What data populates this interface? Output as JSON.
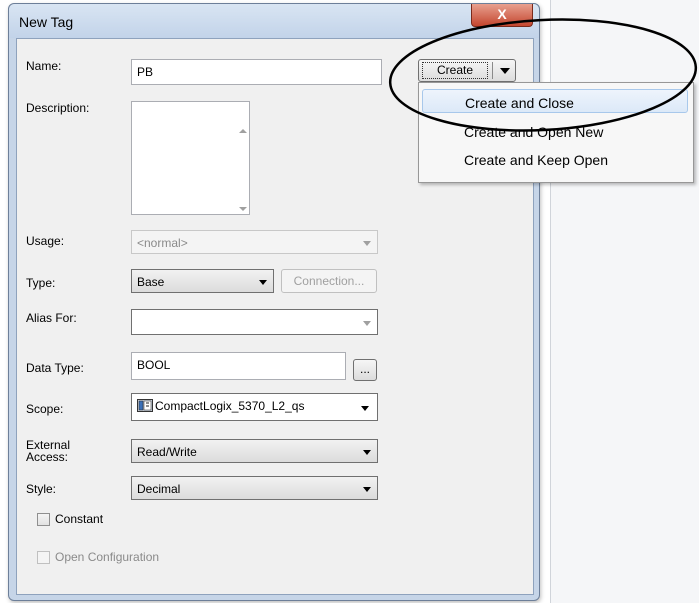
{
  "dialog": {
    "title": "New Tag",
    "close_label": "X"
  },
  "form": {
    "name": {
      "label": "Name:",
      "value": "PB"
    },
    "description": {
      "label": "Description:",
      "value": ""
    },
    "usage": {
      "label": "Usage:",
      "value": "<normal>"
    },
    "type": {
      "label": "Type:",
      "value": "Base",
      "connection_label": "Connection..."
    },
    "alias_for": {
      "label": "Alias For:",
      "value": ""
    },
    "data_type": {
      "label": "Data Type:",
      "value": "BOOL",
      "browse_label": "..."
    },
    "scope": {
      "label": "Scope:",
      "value": "CompactLogix_5370_L2_qs",
      "icon": "controller-icon"
    },
    "external_access": {
      "label_line1": "External",
      "label_line2": "Access:",
      "value": "Read/Write"
    },
    "style": {
      "label": "Style:",
      "value": "Decimal"
    },
    "constant": {
      "label": "Constant",
      "checked": false
    },
    "open_configuration": {
      "label": "Open Configuration",
      "checked": false,
      "enabled": false
    }
  },
  "create_button": {
    "label": "Create"
  },
  "create_menu": {
    "items": [
      {
        "label": "Create and Close",
        "highlighted": true
      },
      {
        "label": "Create and Open New",
        "highlighted": false
      },
      {
        "label": "Create and Keep Open",
        "highlighted": false
      }
    ]
  },
  "colors": {
    "frame": "#c6d5e8",
    "client": "#f0f0f0",
    "close_button": "#c4462f",
    "menu_highlight": "#dce9f8",
    "annotation": "#000000"
  }
}
